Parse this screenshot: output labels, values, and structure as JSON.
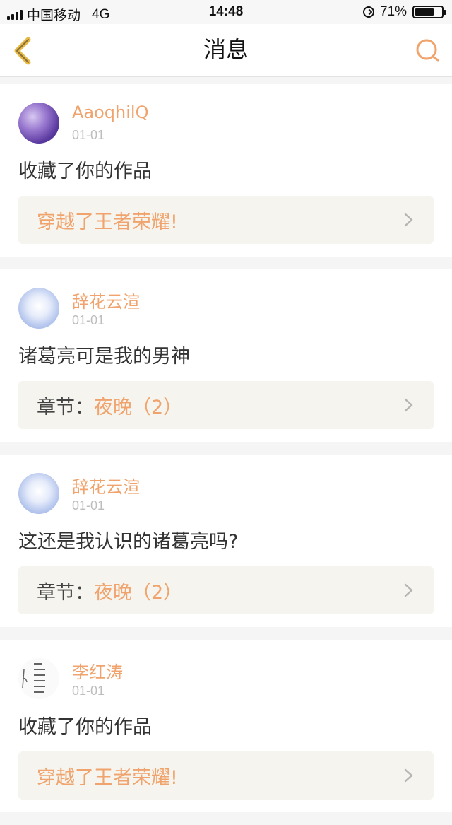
{
  "status_bar": {
    "carrier": "中国移动",
    "network": "4G",
    "time": "14:48",
    "battery_percent": "71%",
    "battery_level": 0.71
  },
  "nav": {
    "title": "消息",
    "accent_color": "#f0a36c"
  },
  "messages": [
    {
      "user": "AaoqhilQ",
      "date": "01-01",
      "text": "收藏了你的作品",
      "ref_prefix": "",
      "ref_title": "穿越了王者荣耀!"
    },
    {
      "user": "辞花云渲",
      "date": "01-01",
      "text": "诸葛亮可是我的男神",
      "ref_prefix": "章节：",
      "ref_title": "夜晚（2）"
    },
    {
      "user": "辞花云渲",
      "date": "01-01",
      "text": "这还是我认识的诸葛亮吗?",
      "ref_prefix": "章节：",
      "ref_title": "夜晚（2）"
    },
    {
      "user": "李红涛",
      "date": "01-01",
      "text": "收藏了你的作品",
      "ref_prefix": "",
      "ref_title": "穿越了王者荣耀!"
    }
  ]
}
